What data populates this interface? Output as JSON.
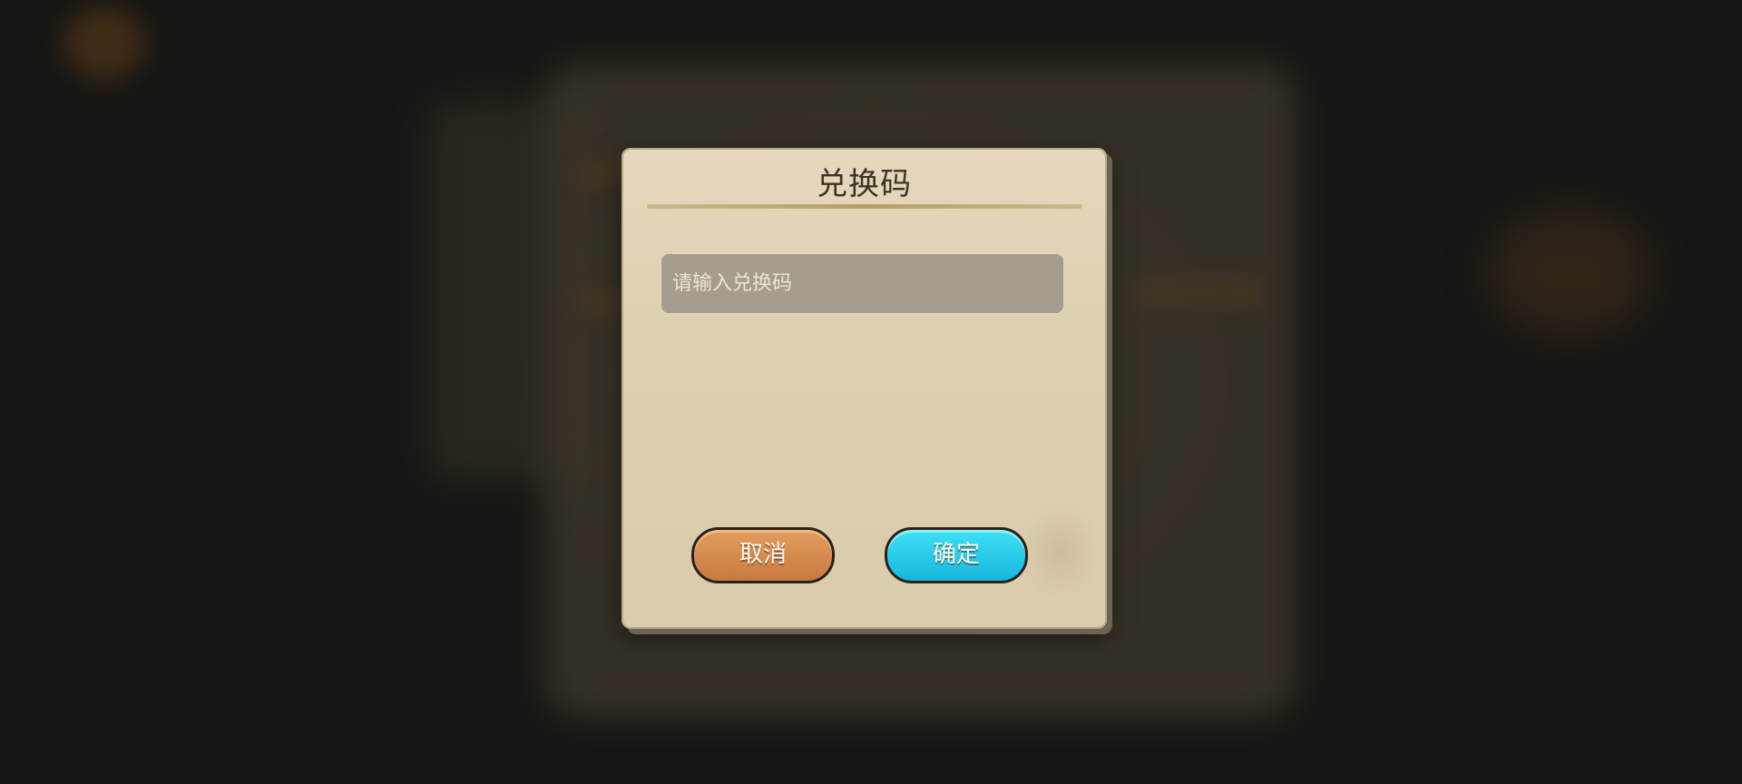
{
  "dialog": {
    "title": "兑换码",
    "input_placeholder": "请输入兑换码",
    "input_value": "",
    "cancel_label": "取消",
    "confirm_label": "确定"
  },
  "colors": {
    "panel": "#ddd0b1",
    "input_bg": "#a59e90",
    "cancel_button": "#d4864b",
    "confirm_button": "#24c6e6"
  }
}
